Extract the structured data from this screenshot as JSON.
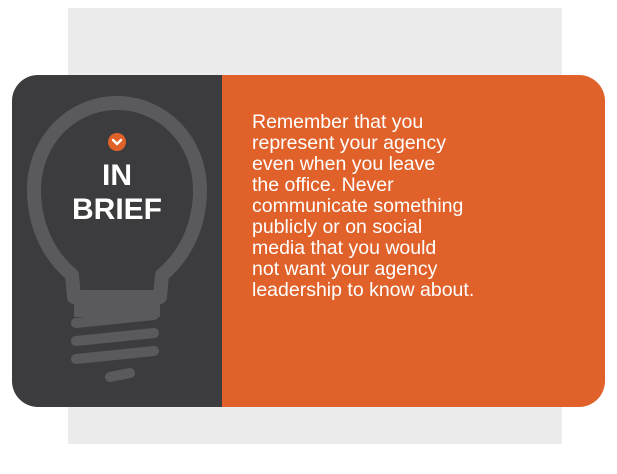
{
  "callout": {
    "title_line1": "IN",
    "title_line2": "BRIEF",
    "icon": "lightbulb-icon",
    "badge_icon": "chevron-down-icon",
    "body": "Remember that you\nrepresent your agency\neven when you leave\nthe office. Never\ncommunicate something\npublicly or on social\nmedia that you would\nnot want your agency\nleadership to know about."
  },
  "colors": {
    "accent": "#e0622a",
    "dark_panel": "#3c3c3e",
    "bulb_outline": "#5a5a5d",
    "backdrop": "#ececec"
  }
}
